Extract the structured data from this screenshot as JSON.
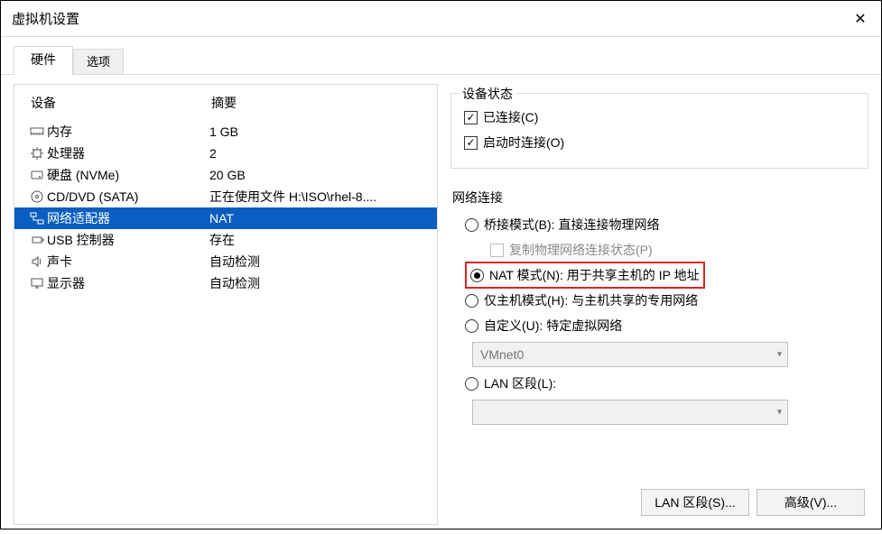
{
  "window": {
    "title": "虚拟机设置"
  },
  "tabs": {
    "hardware": "硬件",
    "options": "选项"
  },
  "hw_header": {
    "device": "设备",
    "summary": "摘要"
  },
  "devices": [
    {
      "name": "内存",
      "summary": "1 GB",
      "icon": "memory"
    },
    {
      "name": "处理器",
      "summary": "2",
      "icon": "cpu"
    },
    {
      "name": "硬盘 (NVMe)",
      "summary": "20 GB",
      "icon": "disk"
    },
    {
      "name": "CD/DVD (SATA)",
      "summary": "正在使用文件 H:\\ISO\\rhel-8....",
      "icon": "disc"
    },
    {
      "name": "网络适配器",
      "summary": "NAT",
      "icon": "net"
    },
    {
      "name": "USB 控制器",
      "summary": "存在",
      "icon": "usb"
    },
    {
      "name": "声卡",
      "summary": "自动检测",
      "icon": "sound"
    },
    {
      "name": "显示器",
      "summary": "自动检测",
      "icon": "display"
    }
  ],
  "status_group": {
    "title": "设备状态",
    "connected": "已连接(C)",
    "connect_at_poweron": "启动时连接(O)"
  },
  "net_group": {
    "title": "网络连接",
    "bridged": "桥接模式(B): 直接连接物理网络",
    "replicate": "复制物理网络连接状态(P)",
    "nat": "NAT 模式(N): 用于共享主机的 IP 地址",
    "hostonly": "仅主机模式(H): 与主机共享的专用网络",
    "custom": "自定义(U): 特定虚拟网络",
    "vmnet_value": "VMnet0",
    "lanseg": "LAN 区段(L):",
    "lanseg_value": ""
  },
  "buttons": {
    "lanseg": "LAN 区段(S)...",
    "advanced": "高级(V)..."
  }
}
